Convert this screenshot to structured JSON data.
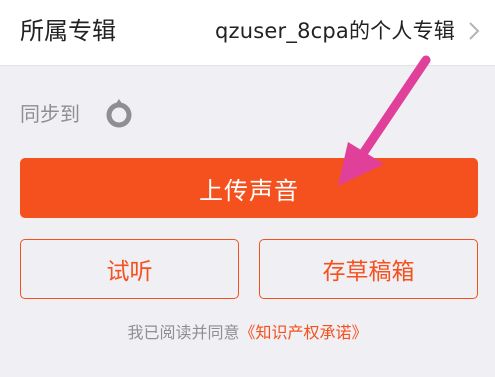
{
  "album": {
    "label": "所属专辑",
    "value": "qzuser_8cpa的个人专辑",
    "chevron_icon": "chevron-right-icon"
  },
  "sync": {
    "label": "同步到",
    "icon": "qzone-sync-icon"
  },
  "buttons": {
    "upload": "上传声音",
    "trial": "试听",
    "draft": "存草稿箱"
  },
  "agreement": {
    "prefix": "我已阅读并同意",
    "link": "《知识产权承诺》"
  },
  "annotation": {
    "type": "arrow",
    "color": "#e0409a",
    "points_to": "upload-button"
  },
  "colors": {
    "accent": "#f5511e",
    "background": "#efeff4",
    "muted_text": "#8e8e93"
  }
}
